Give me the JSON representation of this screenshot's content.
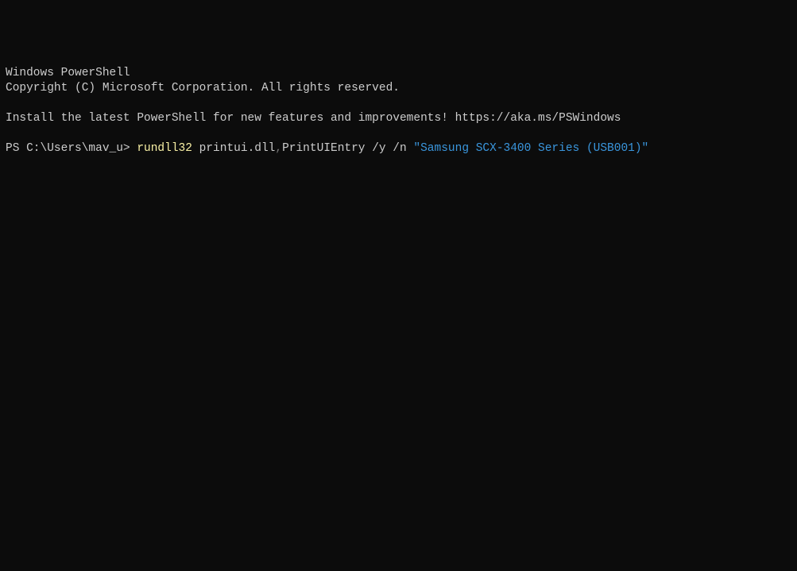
{
  "terminal": {
    "header": {
      "line1": "Windows PowerShell",
      "line2": "Copyright (C) Microsoft Corporation. All rights reserved."
    },
    "install_msg": {
      "text": "Install the latest PowerShell for new features and improvements! ",
      "url": "https://aka.ms/PSWindows"
    },
    "prompt": {
      "ps_prefix": "PS C:\\Users\\mav_u> ",
      "command": "rundll32",
      "args_part1": " printui.dll",
      "comma": ",",
      "args_part2": "PrintUIEntry /y /n ",
      "string_arg": "\"Samsung SCX-3400 Series (USB001)\""
    }
  }
}
